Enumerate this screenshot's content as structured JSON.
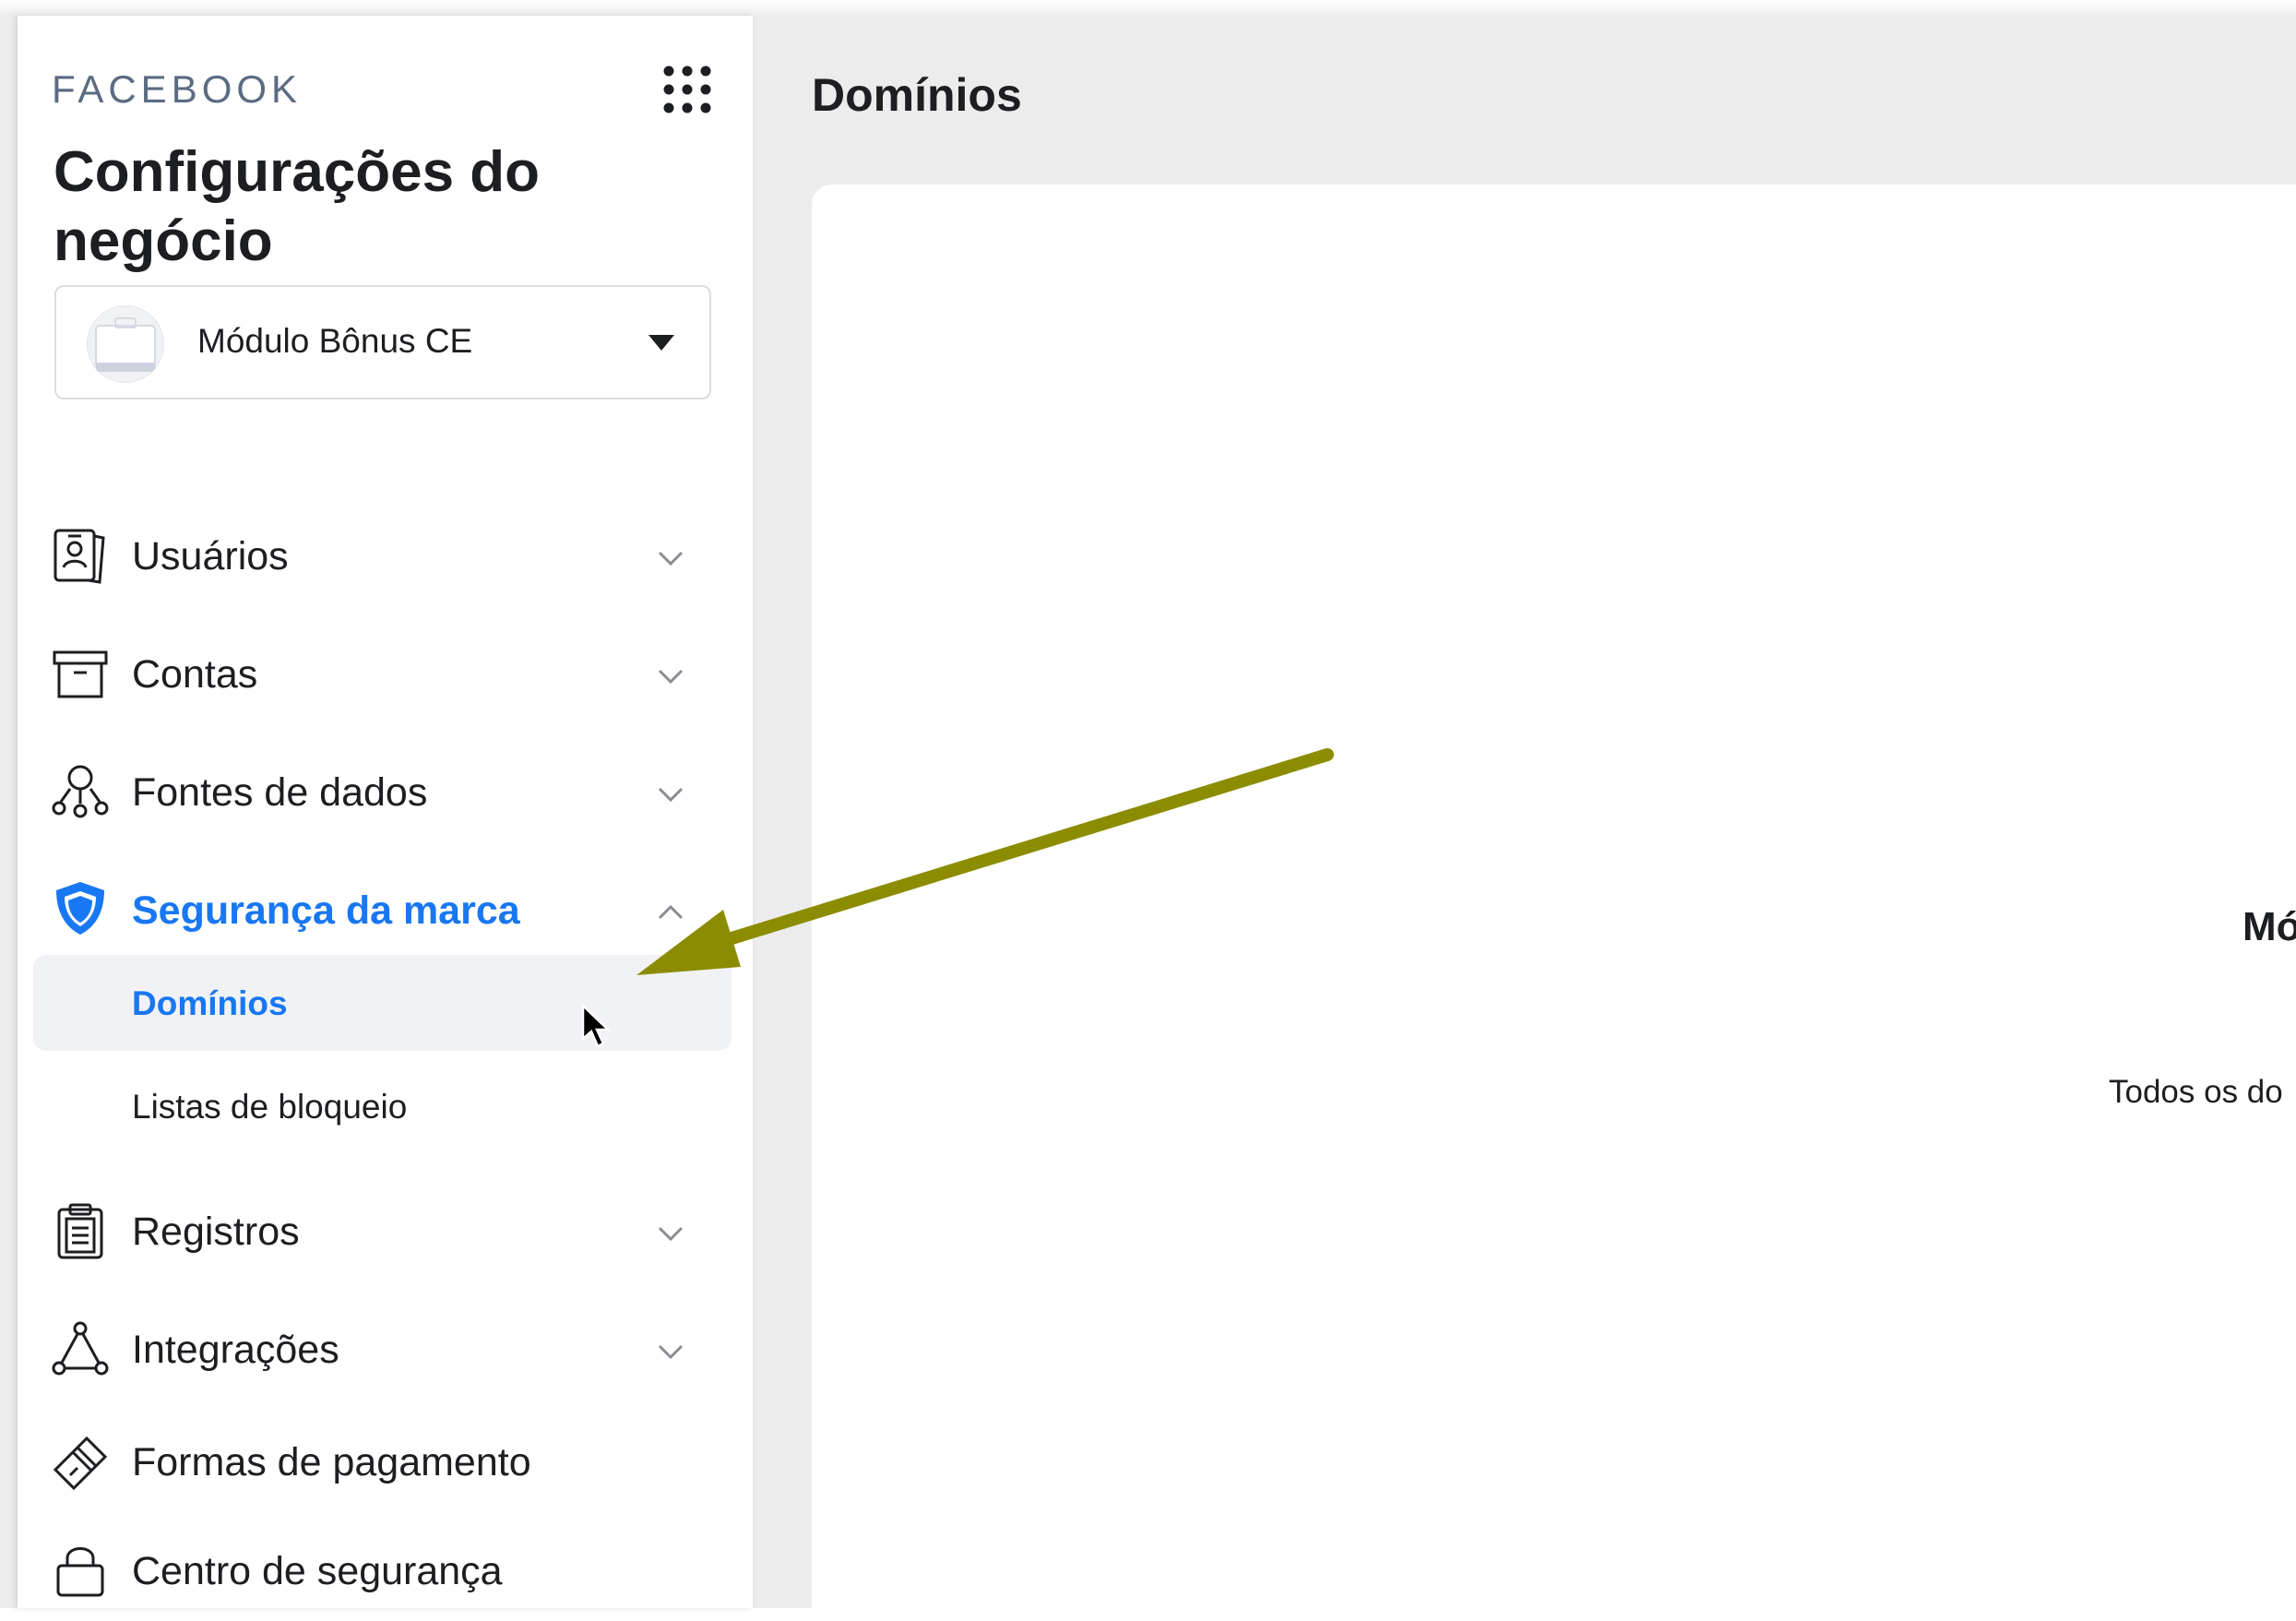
{
  "sidebar": {
    "brand": "FACEBOOK",
    "title": "Configurações do negócio",
    "account": {
      "name": "Módulo Bônus CE"
    },
    "nav": [
      {
        "label": "Usuários",
        "icon": "users-badge-icon"
      },
      {
        "label": "Contas",
        "icon": "archive-box-icon"
      },
      {
        "label": "Fontes de dados",
        "icon": "data-sources-icon"
      },
      {
        "label": "Segurança da marca",
        "icon": "shield-icon",
        "expanded": true,
        "children": [
          {
            "label": "Domínios",
            "selected": true
          },
          {
            "label": "Listas de bloqueio"
          }
        ]
      },
      {
        "label": "Registros",
        "icon": "clipboard-icon"
      },
      {
        "label": "Integrações",
        "icon": "integrations-icon"
      },
      {
        "label": "Formas de pagamento",
        "icon": "credit-card-icon"
      },
      {
        "label": "Centro de segurança",
        "icon": "lock-icon"
      }
    ]
  },
  "main": {
    "title": "Domínios",
    "empty_state": {
      "title_visible": "Mó",
      "description_visible": "Todos os do"
    }
  },
  "colors": {
    "accent": "#1877f2",
    "annotation_arrow": "#8c8c00",
    "background": "#ececec"
  }
}
